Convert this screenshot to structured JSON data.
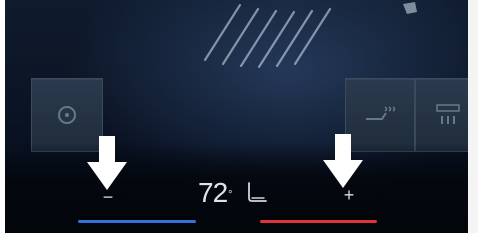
{
  "climate": {
    "temperature": "72",
    "degree_symbol": "°",
    "decrease_label": "−",
    "increase_label": "+"
  },
  "controls": {
    "left_panel_icon": "fan-icon",
    "mid_panel_icon": "seat-heat-icon",
    "right_panel_icon": "rear-defrost-icon",
    "seat_icon": "seat-icon",
    "annotation_arrows": [
      "arrow-down-icon",
      "arrow-down-icon"
    ]
  },
  "colors": {
    "cool_bar": "#3a6fd8",
    "heat_bar": "#e0343b",
    "arrow": "#ffffff",
    "background": "#0b1424"
  }
}
